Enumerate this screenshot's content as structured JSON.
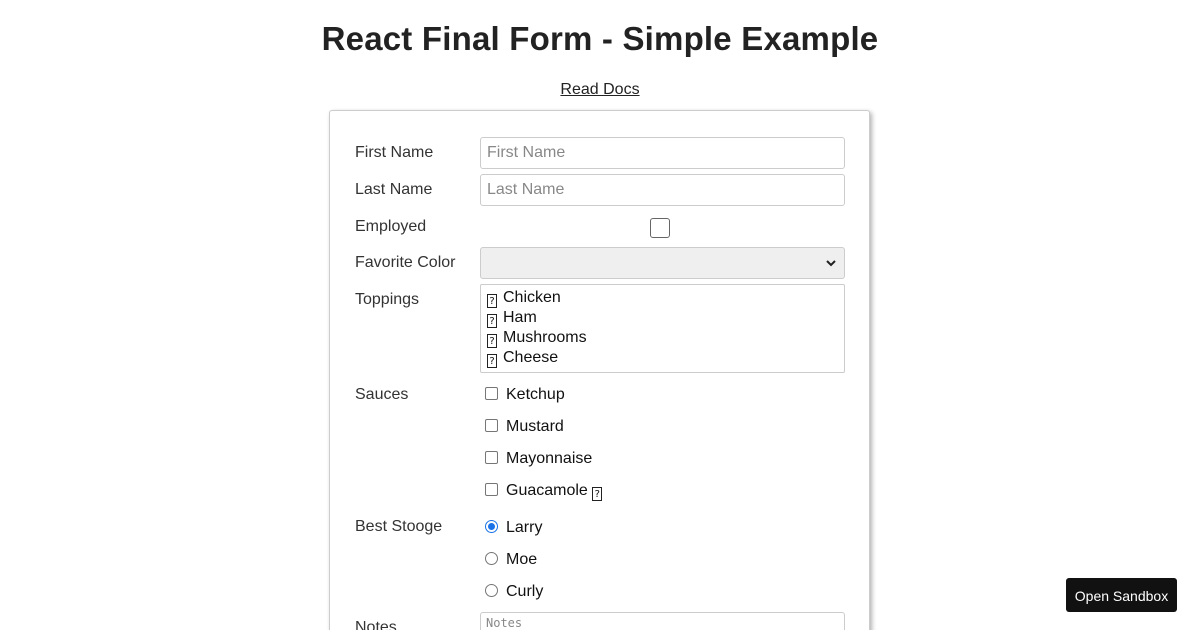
{
  "page": {
    "title": "React Final Form - Simple Example",
    "docs_link": "Read Docs"
  },
  "form": {
    "first_name": {
      "label": "First Name",
      "placeholder": "First Name",
      "value": ""
    },
    "last_name": {
      "label": "Last Name",
      "placeholder": "Last Name",
      "value": ""
    },
    "employed": {
      "label": "Employed",
      "checked": false
    },
    "favorite_color": {
      "label": "Favorite Color",
      "selected": ""
    },
    "toppings": {
      "label": "Toppings",
      "options": [
        "Chicken",
        "Ham",
        "Mushrooms",
        "Cheese"
      ]
    },
    "sauces": {
      "label": "Sauces",
      "options": [
        "Ketchup",
        "Mustard",
        "Mayonnaise",
        "Guacamole"
      ]
    },
    "best_stooge": {
      "label": "Best Stooge",
      "options": [
        "Larry",
        "Moe",
        "Curly"
      ],
      "selected": "Larry"
    },
    "notes": {
      "label": "Notes",
      "placeholder": "Notes"
    }
  },
  "sandbox_button": {
    "label": "Open Sandbox"
  },
  "icons": {
    "missing_glyph": "?",
    "select_chevron": "chevron-down-icon"
  },
  "colors": {
    "accent": "#1a73e8",
    "button_bg": "#111111",
    "border": "#cccccc"
  }
}
